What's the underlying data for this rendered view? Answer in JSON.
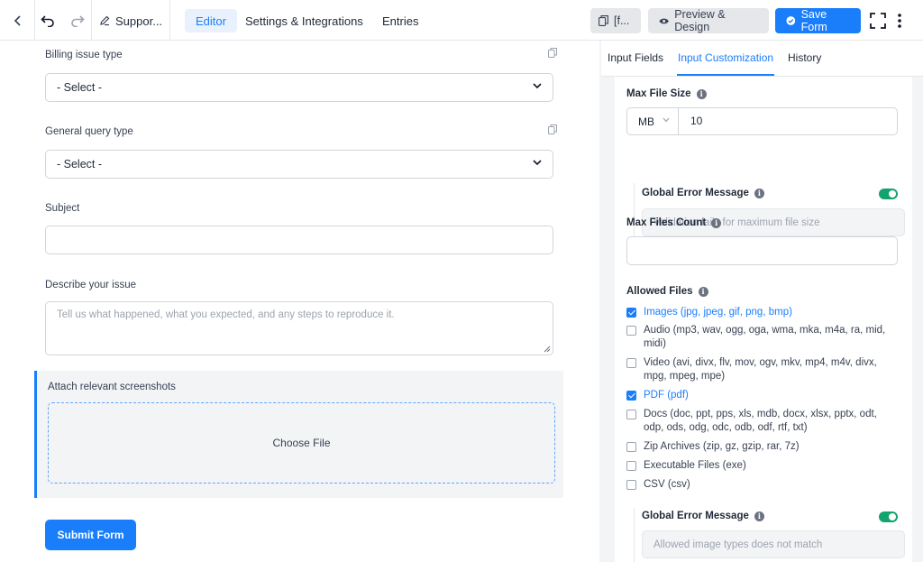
{
  "topbar": {
    "form_title": "Suppor...",
    "tabs": [
      "Editor",
      "Settings & Integrations",
      "Entries"
    ],
    "shortcode_label": "[f...",
    "preview_label": "Preview & Design",
    "save_label": "Save Form"
  },
  "form": {
    "billing_label": "Billing issue type",
    "billing_value": "- Select -",
    "general_label": "General query type",
    "general_value": "- Select -",
    "subject_label": "Subject",
    "describe_label": "Describe your issue",
    "describe_placeholder": "Tell us what happened, what you expected, and any steps to reproduce it.",
    "attach_label": "Attach relevant screenshots",
    "choose_file": "Choose File",
    "submit_label": "Submit Form"
  },
  "panel": {
    "tabs": [
      "Input Fields",
      "Input Customization",
      "History"
    ],
    "max_file_size_label": "Max File Size",
    "unit": "MB",
    "size_value": "10",
    "global_error_label": "Global Error Message",
    "size_error_placeholder": "Validation fails for maximum file size",
    "max_files_label": "Max Files Count",
    "allowed_files_label": "Allowed Files",
    "allowed": [
      {
        "label": "Images (jpg, jpeg, gif, png, bmp)",
        "checked": true
      },
      {
        "label": "Audio (mp3, wav, ogg, oga, wma, mka, m4a, ra, mid, midi)",
        "checked": false
      },
      {
        "label": "Video (avi, divx, flv, mov, ogv, mkv, mp4, m4v, divx, mpg, mpeg, mpe)",
        "checked": false
      },
      {
        "label": "PDF (pdf)",
        "checked": true
      },
      {
        "label": "Docs (doc, ppt, pps, xls, mdb, docx, xlsx, pptx, odt, odp, ods, odg, odc, odb, odf, rtf, txt)",
        "checked": false
      },
      {
        "label": "Zip Archives (zip, gz, gzip, rar, 7z)",
        "checked": false
      },
      {
        "label": "Executable Files (exe)",
        "checked": false
      },
      {
        "label": "CSV (csv)",
        "checked": false
      }
    ],
    "global_error_label_2": "Global Error Message",
    "type_error_placeholder": "Allowed image types does not match"
  },
  "colors": {
    "accent": "#1a7efb",
    "toggle_on": "#13a36e"
  }
}
